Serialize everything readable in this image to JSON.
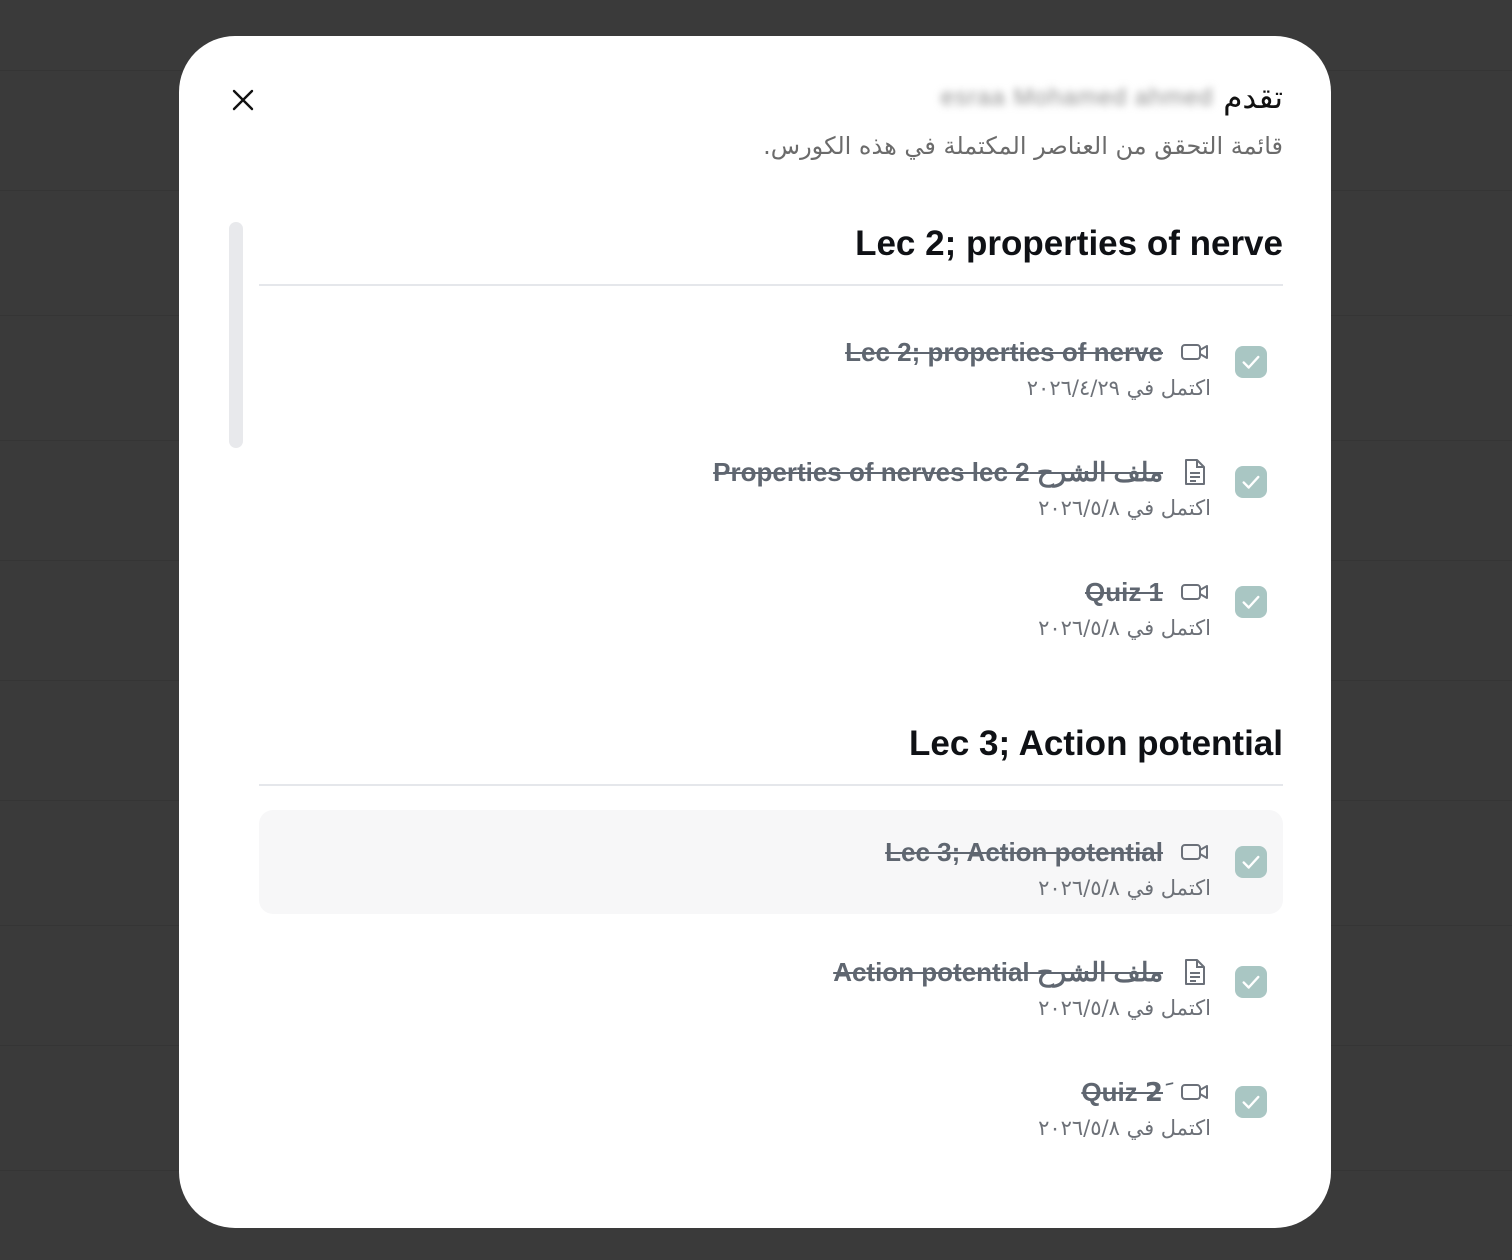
{
  "modal": {
    "title": "تقدم",
    "student_name": "esraa Mohamed ahmed",
    "subtitle": "قائمة التحقق من العناصر المكتملة في هذه الكورس."
  },
  "colors": {
    "check_bg": "#a9c6c3",
    "title_text": "#5f6670",
    "overlay": "#3a3a3a"
  },
  "sections": [
    {
      "title": "Lec 2; properties of nerve",
      "items": [
        {
          "title": "Lec 2; properties of nerve",
          "icon": "video-icon",
          "date": "اكتمل في ٢٠٢٦/٤/٢٩"
        },
        {
          "title": "ملف الشرح Properties of nerves lec 2",
          "icon": "document-icon",
          "date": "اكتمل في ٢٠٢٦/٥/٨"
        },
        {
          "title": "Quiz 1",
          "icon": "video-icon",
          "date": "اكتمل في ٢٠٢٦/٥/٨"
        }
      ]
    },
    {
      "title": "Lec 3; Action potential",
      "items": [
        {
          "title": "Lec 3; Action potential",
          "icon": "video-icon",
          "date": "اكتمل في ٢٠٢٦/٥/٨"
        },
        {
          "title": "ملف الشرح Action potential",
          "icon": "document-icon",
          "date": "اكتمل في ٢٠٢٦/٥/٨"
        },
        {
          "title": "Quiz 2َ",
          "icon": "video-icon",
          "date": "اكتمل في ٢٠٢٦/٥/٨"
        }
      ]
    }
  ]
}
